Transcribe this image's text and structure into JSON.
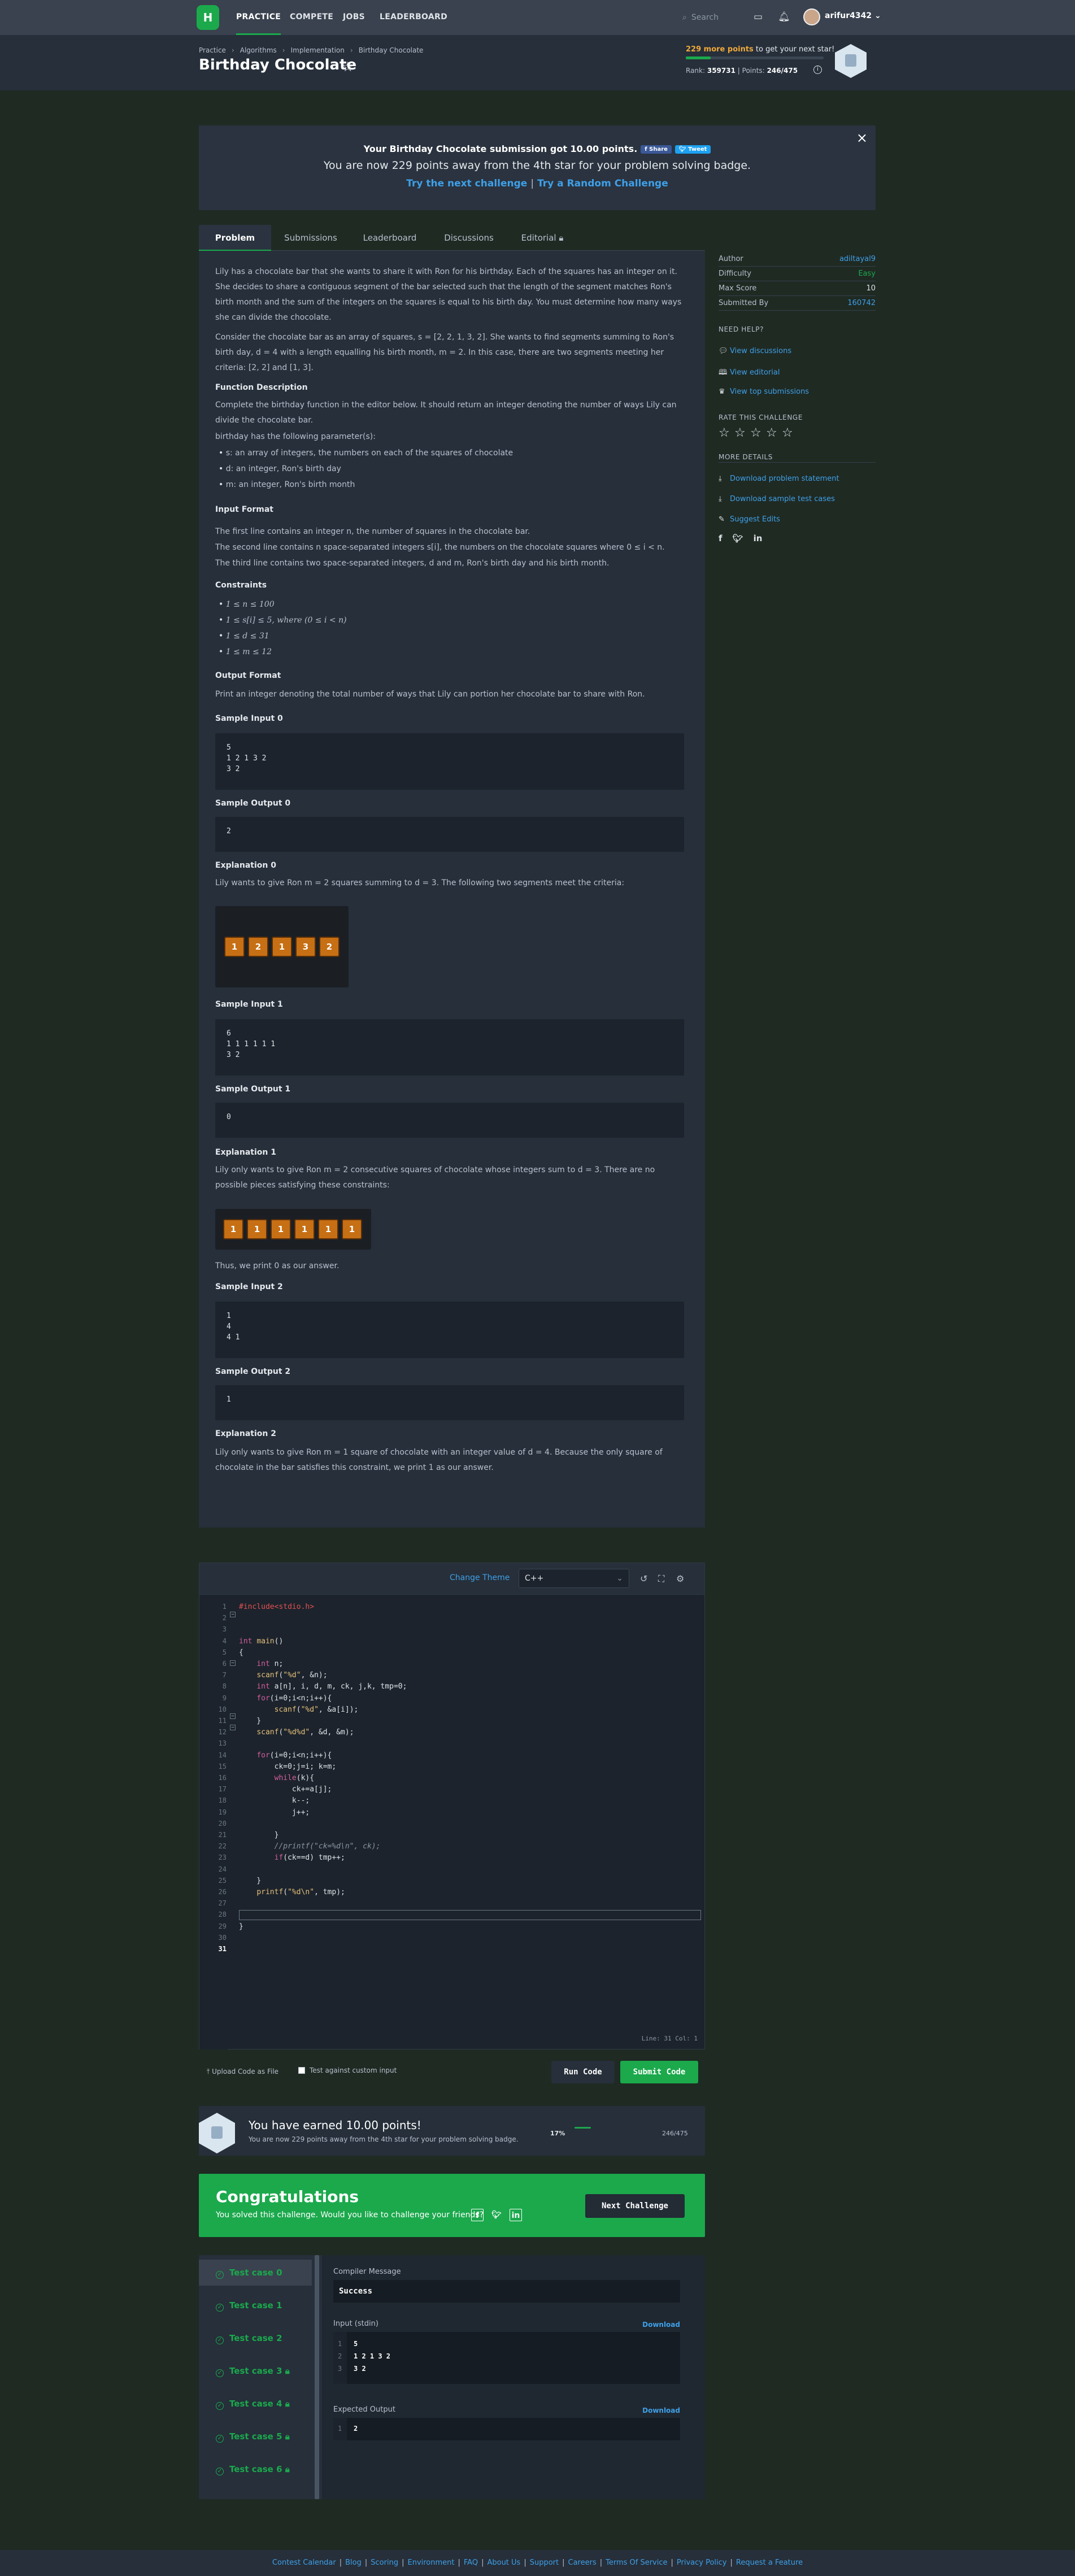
{
  "nav": {
    "logo": "H",
    "links": [
      "PRACTICE",
      "COMPETE",
      "JOBS",
      "LEADERBOARD"
    ],
    "search_placeholder": "Search",
    "username": "arifur4342"
  },
  "header": {
    "breadcrumb": [
      "Practice",
      "Algorithms",
      "Implementation",
      "Birthday Chocolate"
    ],
    "title": "Birthday Chocolate",
    "next_star_points": "229 more points",
    "next_star_rest": " to get your next star!",
    "rank_label": "Rank:",
    "rank": "359731",
    "points_label": "Points:",
    "points": "246/475",
    "progress_fraction": 0.18
  },
  "banner": {
    "line1": "Your Birthday Chocolate submission got 10.00 points.",
    "share": "Share",
    "tweet": "Tweet",
    "line2": "You are now 229 points away from the 4th star for your problem solving badge.",
    "link1": "Try the next challenge",
    "sep": "|",
    "link2": "Try a Random Challenge",
    "close": "×"
  },
  "tabs": [
    "Problem",
    "Submissions",
    "Leaderboard",
    "Discussions",
    "Editorial"
  ],
  "problem": {
    "intro": "Lily has a chocolate bar that she wants to share it with Ron for his birthday. Each of the squares has an integer on it. She decides to share a contiguous segment of the bar selected such that the length of the segment matches Ron's birth month and the sum of the integers on the squares is equal to his birth day. You must determine how many ways she can divide the chocolate.",
    "consider": "Consider the chocolate bar as an array of squares, s = [2, 2, 1, 3, 2]. She wants to find segments summing to Ron's birth day, d = 4 with a length equalling his birth month, m = 2. In this case, there are two segments meeting her criteria: [2, 2] and [1, 3].",
    "fd_title": "Function Description",
    "fd_text": "Complete the birthday function in the editor below. It should return an integer denoting the number of ways Lily can divide the chocolate bar.",
    "params_intro": "birthday has the following parameter(s):",
    "params": [
      "s: an array of integers, the numbers on each of the squares of chocolate",
      "d: an integer, Ron's birth day",
      "m: an integer, Ron's birth month"
    ],
    "if_title": "Input Format",
    "if_lines": [
      "The first line contains an integer n, the number of squares in the chocolate bar.",
      "The second line contains n space-separated integers s[i], the numbers on the chocolate squares where 0 ≤ i < n.",
      "The third line contains two space-separated integers, d and m, Ron's birth day and his birth month."
    ],
    "c_title": "Constraints",
    "constraints": [
      "1 ≤ n ≤ 100",
      "1 ≤ s[i] ≤ 5, where (0 ≤ i < n)",
      "1 ≤ d ≤ 31",
      "1 ≤ m ≤ 12"
    ],
    "of_title": "Output Format",
    "of_text": "Print an integer denoting the total number of ways that Lily can portion her chocolate bar to share with Ron.",
    "si0_title": "Sample Input 0",
    "si0": "5\n1 2 1 3 2\n3 2",
    "so0_title": "Sample Output 0",
    "so0": "2",
    "ex0_title": "Explanation 0",
    "ex0": "Lily wants to give Ron m = 2 squares summing to d = 3. The following two segments meet the criteria:",
    "choc0": [
      "1",
      "2",
      "1",
      "3",
      "2"
    ],
    "si1_title": "Sample Input 1",
    "si1": "6\n1 1 1 1 1 1\n3 2",
    "so1_title": "Sample Output 1",
    "so1": "0",
    "ex1_title": "Explanation 1",
    "ex1": "Lily only wants to give Ron m = 2 consecutive squares of chocolate whose integers sum to d = 3. There are no possible pieces satisfying these constraints:",
    "choc1": [
      "1",
      "1",
      "1",
      "1",
      "1",
      "1"
    ],
    "ex1_after": "Thus, we print 0 as our answer.",
    "si2_title": "Sample Input 2",
    "si2": "1\n4\n4 1",
    "so2_title": "Sample Output 2",
    "so2": "1",
    "ex2_title": "Explanation 2",
    "ex2": "Lily only wants to give Ron m = 1 square of chocolate with an integer value of d = 4. Because the only square of chocolate in the bar satisfies this constraint, we print 1 as our answer."
  },
  "sidebar": {
    "author_label": "Author",
    "author": "adiltayal9",
    "difficulty_label": "Difficulty",
    "difficulty": "Easy",
    "maxscore_label": "Max Score",
    "maxscore": "10",
    "submitted_label": "Submitted By",
    "submitted": "160742",
    "help_title": "NEED HELP?",
    "help_links": [
      "View discussions",
      "View editorial",
      "View top submissions"
    ],
    "rate_title": "RATE THIS CHALLENGE",
    "rating_filled": 0,
    "more_title": "MORE DETAILS",
    "more_links": [
      "Download problem statement",
      "Download sample test cases",
      "Suggest Edits"
    ]
  },
  "editor": {
    "change_theme": "Change Theme",
    "language": "C++",
    "status": "Line: 31 Col: 1",
    "lines": [
      "#include<stdio.h>",
      "",
      "",
      "int main()",
      "{",
      "    int n;",
      "    scanf(\"%d\", &n);",
      "    int a[n], i, d, m, ck, j,k, tmp=0;",
      "    for(i=0;i<n;i++){",
      "        scanf(\"%d\", &a[i]);",
      "    }",
      "    scanf(\"%d%d\", &d, &m);",
      "",
      "    for(i=0;i<n;i++){",
      "        ck=0;j=i; k=m;",
      "        while(k){",
      "            ck+=a[j];",
      "            k--;",
      "            j++;",
      "",
      "        }",
      "        //printf(\"ck=%d\\n\", ck);",
      "        if(ck==d) tmp++;",
      "",
      "    }",
      "    printf(\"%d\\n\", tmp);",
      "",
      "",
      "}",
      "",
      ""
    ]
  },
  "actions": {
    "upload": "Upload Code as File",
    "custom": "Test against custom input",
    "run": "Run Code",
    "submit": "Submit Code"
  },
  "earned": {
    "title": "You have earned 10.00 points!",
    "sub": "You are now 229 points away from the 4th star for your problem solving badge.",
    "percent": "17%",
    "points": "246/475",
    "progress_fraction": 0.17
  },
  "congrats": {
    "title": "Congratulations",
    "text": "You solved this challenge. Would you like to challenge your friends?",
    "button": "Next Challenge"
  },
  "tests": {
    "cases": [
      "Test case 0",
      "Test case 1",
      "Test case 2",
      "Test case 3",
      "Test case 4",
      "Test case 5",
      "Test case 6"
    ],
    "compiler_label": "Compiler Message",
    "compiler_msg": "Success",
    "input_label": "Input (stdin)",
    "download": "Download",
    "input_lines": [
      "5",
      "1 2 1 3 2",
      "3 2"
    ],
    "expected_label": "Expected Output",
    "expected_lines": [
      "2"
    ]
  },
  "footer": [
    "Contest Calendar",
    "Blog",
    "Scoring",
    "Environment",
    "FAQ",
    "About Us",
    "Support",
    "Careers",
    "Terms Of Service",
    "Privacy Policy",
    "Request a Feature"
  ]
}
